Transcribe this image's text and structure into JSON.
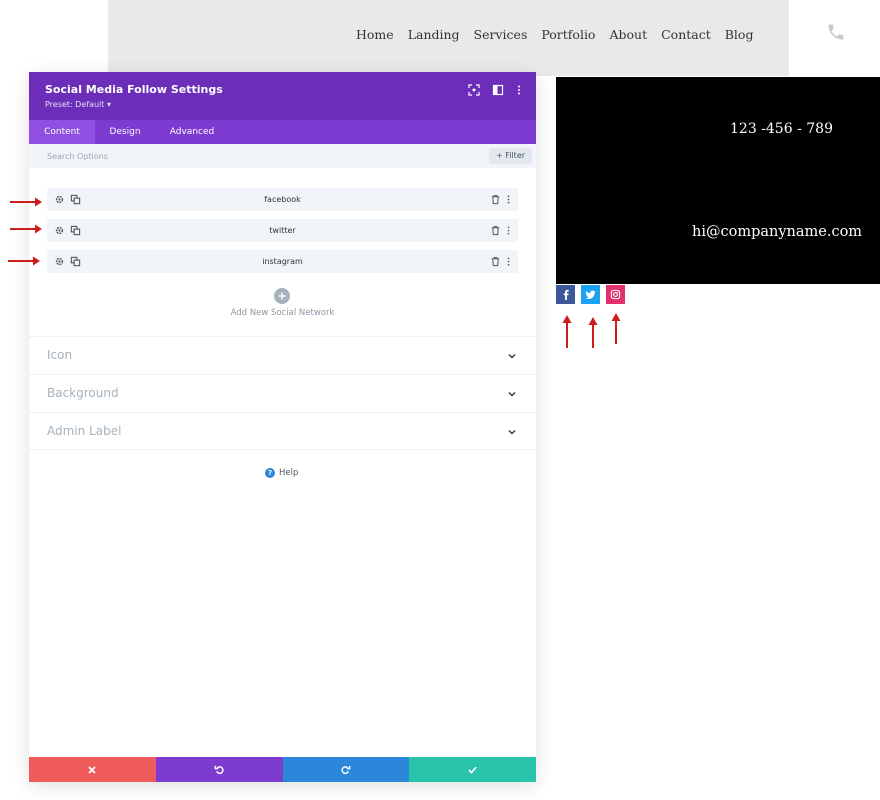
{
  "site": {
    "nav": [
      "Home",
      "Landing",
      "Services",
      "Portfolio",
      "About",
      "Contact",
      "Blog"
    ],
    "phone_icon": "phone-icon"
  },
  "modal": {
    "title": "Social Media Follow Settings",
    "preset": "Preset: Default",
    "tabs": [
      "Content",
      "Design",
      "Advanced"
    ],
    "active_tab": "Content",
    "search_placeholder": "Search Options",
    "filter_label": "Filter",
    "networks": [
      "facebook",
      "twitter",
      "instagram"
    ],
    "add_label": "Add New Social Network",
    "sections": [
      "Icon",
      "Background",
      "Admin Label"
    ],
    "help_label": "Help",
    "colors": {
      "header": "#6c2eb9",
      "tabs": "#7d3bd1",
      "cancel": "#ef5b5b",
      "undo": "#7e3bd0",
      "redo": "#2b87da",
      "save": "#29c4a9"
    }
  },
  "preview": {
    "phone_text": "123 -456 - 789",
    "email_text": "hi@companyname.com",
    "social_colors": {
      "facebook": "#3b5998",
      "twitter": "#1da1f2",
      "instagram": "#e1306c"
    }
  }
}
